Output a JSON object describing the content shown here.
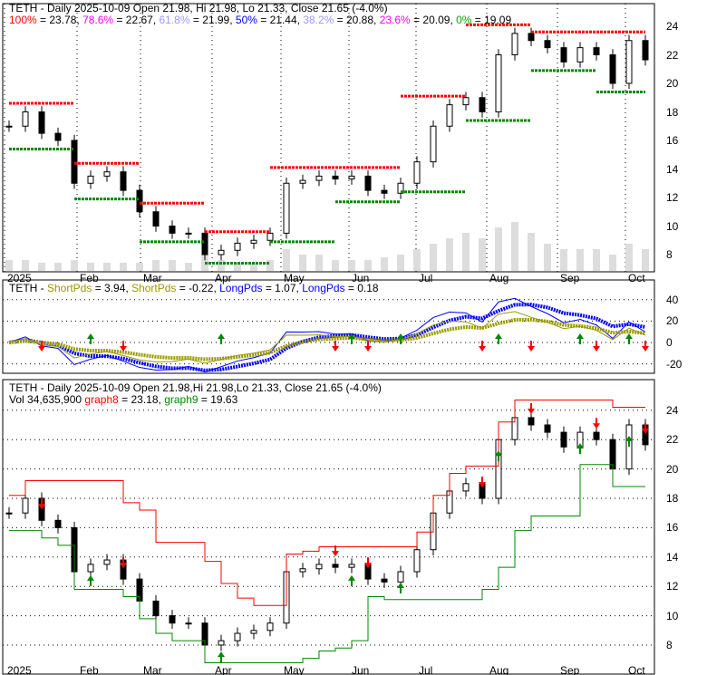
{
  "panel1": {
    "title": "TETH - Daily 2025-10-09 Open 21.98, Hi 21.98, Lo 21.33, Close 21.65 (-4.0%)",
    "fib": [
      {
        "label": "100%",
        "value": "23.78",
        "color": "#ff0000"
      },
      {
        "label": "78.6%",
        "value": "22.67",
        "color": "#ff00ff"
      },
      {
        "label": "61.8%",
        "value": "21.99",
        "color": "#9999ff"
      },
      {
        "label": "50%",
        "value": "21.44",
        "color": "#0000ff"
      },
      {
        "label": "38.2%",
        "value": "20.88",
        "color": "#9999ff"
      },
      {
        "label": "23.6%",
        "value": "20.09",
        "color": "#ff00ff"
      },
      {
        "label": "0%",
        "value": "19.09",
        "color": "#00aa00"
      }
    ]
  },
  "panel2": {
    "prefix": "TETH - ",
    "items": [
      {
        "label": "ShortPds",
        "value": "3.94",
        "color": "#999900"
      },
      {
        "label": "ShortPds",
        "value": "-0.22",
        "color": "#999900"
      },
      {
        "label": "LongPds",
        "value": "1.07",
        "color": "#0000ff"
      },
      {
        "label": "LongPds",
        "value": "0.18",
        "color": "#0000ff"
      }
    ]
  },
  "panel3": {
    "title": "TETH - Daily 2025-10-09 Open 21.98,Hi 21.98,Lo 21.33, Close 21.65 (-4.0%)",
    "vol": "Vol 34,635,900",
    "g8_label": "graph8",
    "g8_value": "23.18",
    "g9_label": "graph9",
    "g9_value": "19.63"
  },
  "chart_data": {
    "type": "candlestick",
    "months": [
      "2025",
      "Feb",
      "Mar",
      "Apr",
      "May",
      "Jun",
      "Jul",
      "Aug",
      "Sep",
      "Oct"
    ],
    "price_ticks": [
      8,
      10,
      12,
      14,
      16,
      18,
      20,
      22,
      24
    ],
    "osc_ticks": [
      40,
      20,
      0,
      -20
    ],
    "weekly_close": [
      17,
      18,
      16.5,
      16,
      13,
      13.5,
      13.8,
      12.5,
      11,
      10,
      9.5,
      9.5,
      8,
      8.3,
      8.8,
      9,
      9.5,
      13,
      13.2,
      13.5,
      13.3,
      13.5,
      12.5,
      12.3,
      13,
      14.5,
      17,
      18.5,
      19,
      18,
      22,
      23.5,
      23,
      22.5,
      21.5,
      22.5,
      22,
      20,
      23,
      21.65
    ],
    "volume": [
      2,
      2,
      1.5,
      1.5,
      2,
      1.5,
      1.5,
      1.5,
      1.5,
      2,
      2,
      1.5,
      3,
      2,
      1.5,
      1.5,
      2,
      4,
      3,
      3,
      2,
      2,
      2,
      2.5,
      3,
      4,
      5,
      6,
      7,
      6,
      8,
      9,
      7,
      5,
      4,
      4,
      4,
      3,
      5,
      4
    ]
  }
}
